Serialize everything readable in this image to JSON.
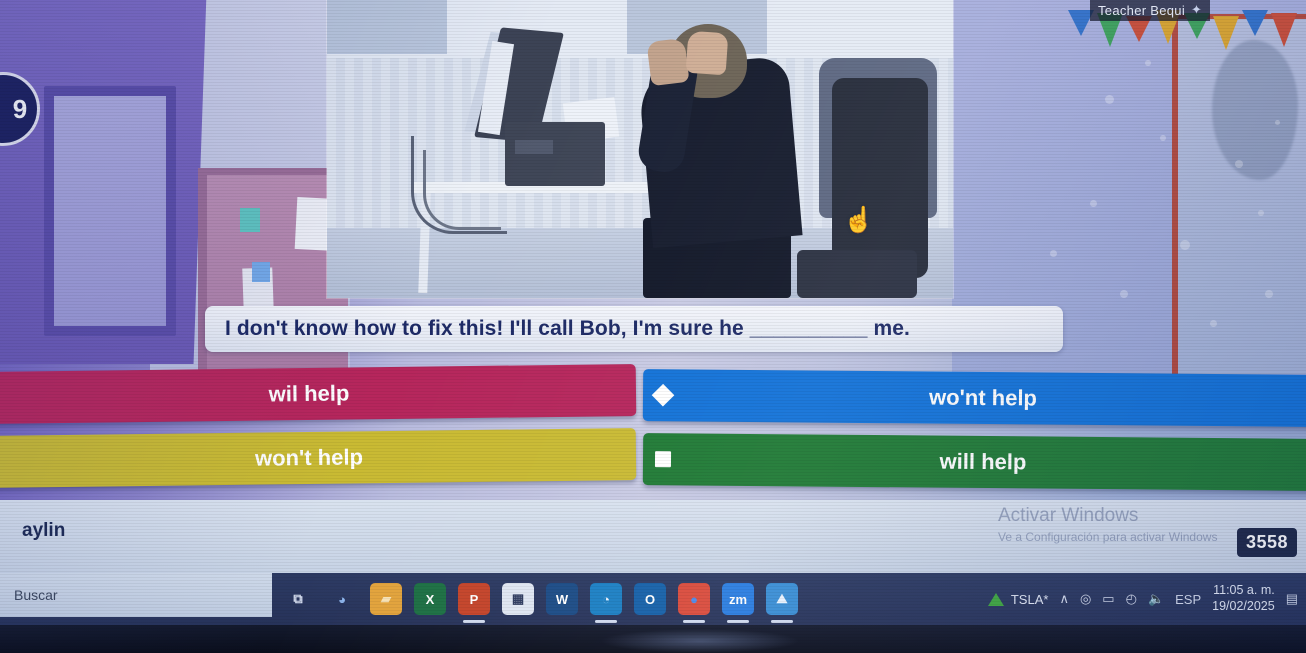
{
  "quiz": {
    "teacher_label": "Teacher Bequi",
    "teacher_icon": "sparkle-icon",
    "corner_badge": "9",
    "question": "I don't know how to fix this! I'll call Bob, I'm sure he __________ me.",
    "answers": [
      {
        "label": "wil help",
        "shape": "triangle",
        "color": "#b6265c"
      },
      {
        "label": "wo'nt help",
        "shape": "diamond",
        "color": "#1272d8"
      },
      {
        "label": "won't help",
        "shape": "circle",
        "color": "#c9ba33"
      },
      {
        "label": "will help",
        "shape": "square",
        "color": "#1f7a35"
      }
    ],
    "player_name": "aylin",
    "score": "3558",
    "watermark": {
      "title": "Activar Windows",
      "subtitle": "Ve a Configuración para activar Windows"
    }
  },
  "taskbar": {
    "search_placeholder": "Buscar",
    "apps": [
      {
        "name": "task-view-icon",
        "glyph": "⧉",
        "color": "transparent",
        "text": "#d8e0f2"
      },
      {
        "name": "copilot-icon",
        "glyph": "◕",
        "color": "transparent",
        "text": "#8fb7ef"
      },
      {
        "name": "file-explorer-icon",
        "glyph": "▰",
        "color": "#e2a33c",
        "text": "#f7e2b5"
      },
      {
        "name": "excel-icon",
        "glyph": "X",
        "color": "#1d7044",
        "text": "#ffffff"
      },
      {
        "name": "powerpoint-icon",
        "glyph": "P",
        "color": "#c4442a",
        "text": "#ffffff"
      },
      {
        "name": "microsoft-store-icon",
        "glyph": "▦",
        "color": "#dfe6f2",
        "text": "#2d3a5e"
      },
      {
        "name": "word-icon",
        "glyph": "W",
        "color": "#1b4b86",
        "text": "#ffffff"
      },
      {
        "name": "edge-icon",
        "glyph": "◔",
        "color": "#1b7fc4",
        "text": "#e9f3ff"
      },
      {
        "name": "outlook-icon",
        "glyph": "O",
        "color": "#1560a8",
        "text": "#ffffff"
      },
      {
        "name": "chrome-icon",
        "glyph": "●",
        "color": "#d94b3c",
        "text": "#4e89e8"
      },
      {
        "name": "zoom-icon",
        "glyph": "zm",
        "color": "#2a7de1",
        "text": "#ffffff"
      },
      {
        "name": "photos-icon",
        "glyph": "⛰",
        "color": "#3a8fd6",
        "text": "#eaf4ff"
      }
    ],
    "tray": {
      "stock_label": "TSLA*",
      "chevron": "∧",
      "camera_icon": "◎",
      "battery_icon": "▭",
      "wifi_icon": "◴",
      "volume_icon": "ὐA",
      "language": "ESP",
      "time": "11:05 a. m.",
      "date": "19/02/2025",
      "notifications_icon": "▤"
    }
  }
}
